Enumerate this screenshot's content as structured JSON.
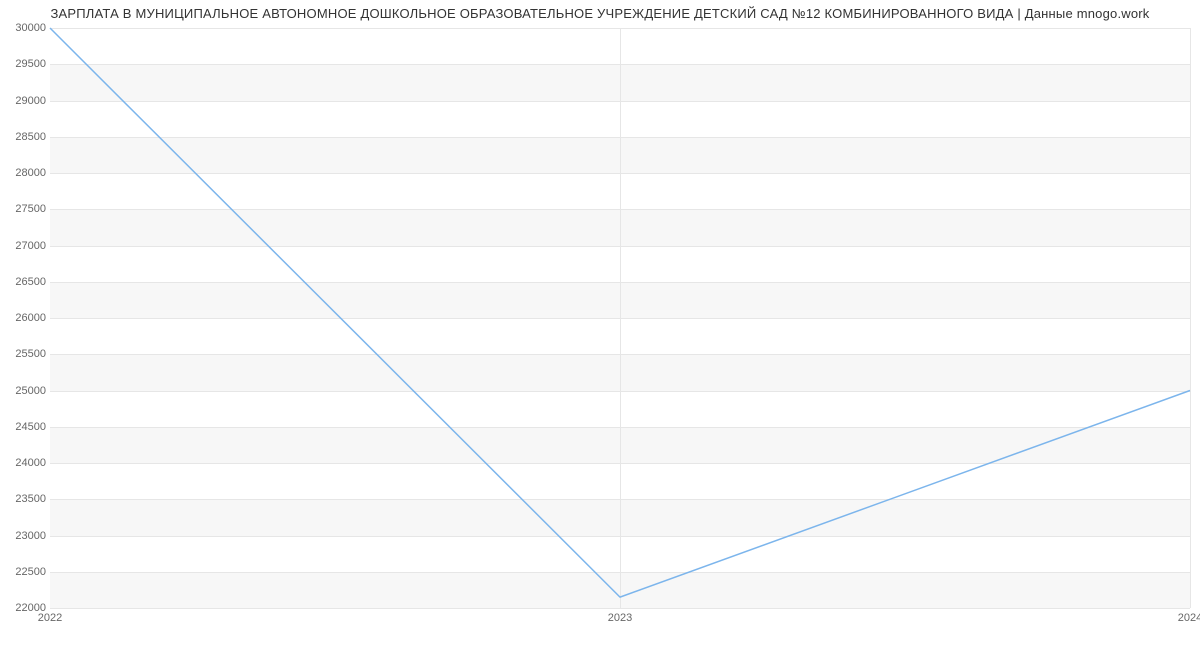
{
  "title": "ЗАРПЛАТА В МУНИЦИПАЛЬНОЕ АВТОНОМНОЕ ДОШКОЛЬНОЕ ОБРАЗОВАТЕЛЬНОЕ УЧРЕЖДЕНИЕ ДЕТСКИЙ САД №12 КОМБИНИРОВАННОГО ВИДА | Данные mnogo.work",
  "colors": {
    "line": "#7cb5ec"
  },
  "chart_data": {
    "type": "line",
    "title": "ЗАРПЛАТА В МУНИЦИПАЛЬНОЕ АВТОНОМНОЕ ДОШКОЛЬНОЕ ОБРАЗОВАТЕЛЬНОЕ УЧРЕЖДЕНИЕ ДЕТСКИЙ САД №12 КОМБИНИРОВАННОГО ВИДА | Данные mnogo.work",
    "xlabel": "",
    "ylabel": "",
    "categories": [
      "2022",
      "2023",
      "2024"
    ],
    "x": [
      2022,
      2023,
      2024
    ],
    "values": [
      30000,
      22150,
      25000
    ],
    "ylim": [
      22000,
      30000
    ],
    "yticks": [
      22000,
      22500,
      23000,
      23500,
      24000,
      24500,
      25000,
      25500,
      26000,
      26500,
      27000,
      27500,
      28000,
      28500,
      29000,
      29500,
      30000
    ],
    "grid": true
  }
}
